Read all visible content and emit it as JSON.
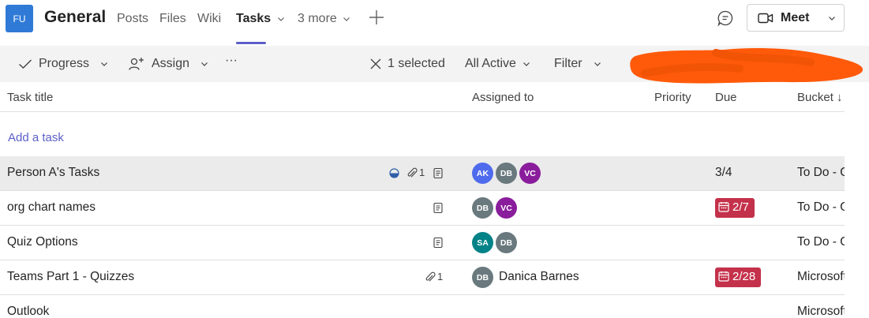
{
  "header": {
    "team_initials": "FU",
    "channel_name": "General",
    "tabs": [
      {
        "label": "Posts"
      },
      {
        "label": "Files"
      },
      {
        "label": "Wiki"
      },
      {
        "label": "Tasks"
      },
      {
        "label": "3 more"
      }
    ],
    "meet_label": "Meet"
  },
  "toolbar": {
    "progress_label": "Progress",
    "assign_label": "Assign",
    "more_label": "···",
    "selected_label": "1 selected",
    "filter_active_label": "All Active",
    "filter_label": "Filter"
  },
  "table": {
    "columns": {
      "title": "Task title",
      "assigned": "Assigned to",
      "priority": "Priority",
      "due": "Due",
      "bucket": "Bucket ↓"
    },
    "add_task_label": "Add a task",
    "rows": [
      {
        "title": "Person A's Tasks",
        "attachments": "1",
        "assignees": [
          "AK",
          "DB",
          "VC"
        ],
        "due": "3/4",
        "bucket": "To Do - Quizzes"
      },
      {
        "title": "org chart names",
        "assignees": [
          "DB",
          "VC"
        ],
        "due": "2/7",
        "bucket": "To Do - Quizzes"
      },
      {
        "title": "Quiz Options",
        "assignees": [
          "SA",
          "DB"
        ],
        "due": "",
        "bucket": "To Do - Quizzes"
      },
      {
        "title": "Teams Part 1 - Quizzes",
        "attachments": "1",
        "assignees": [
          "DB"
        ],
        "assignee_name": "Danica Barnes",
        "due": "2/28",
        "bucket": "Microsoft"
      },
      {
        "title": "Outlook",
        "bucket": "Microsoft"
      }
    ]
  },
  "colors": {
    "accent": "#5b5fc7",
    "late": "#c4314b",
    "avatar_ak": "#4f6bed",
    "avatar_db": "#69797e",
    "avatar_vc": "#8a1d9c",
    "avatar_sa": "#038387",
    "redaction": "#ff5a0a"
  }
}
